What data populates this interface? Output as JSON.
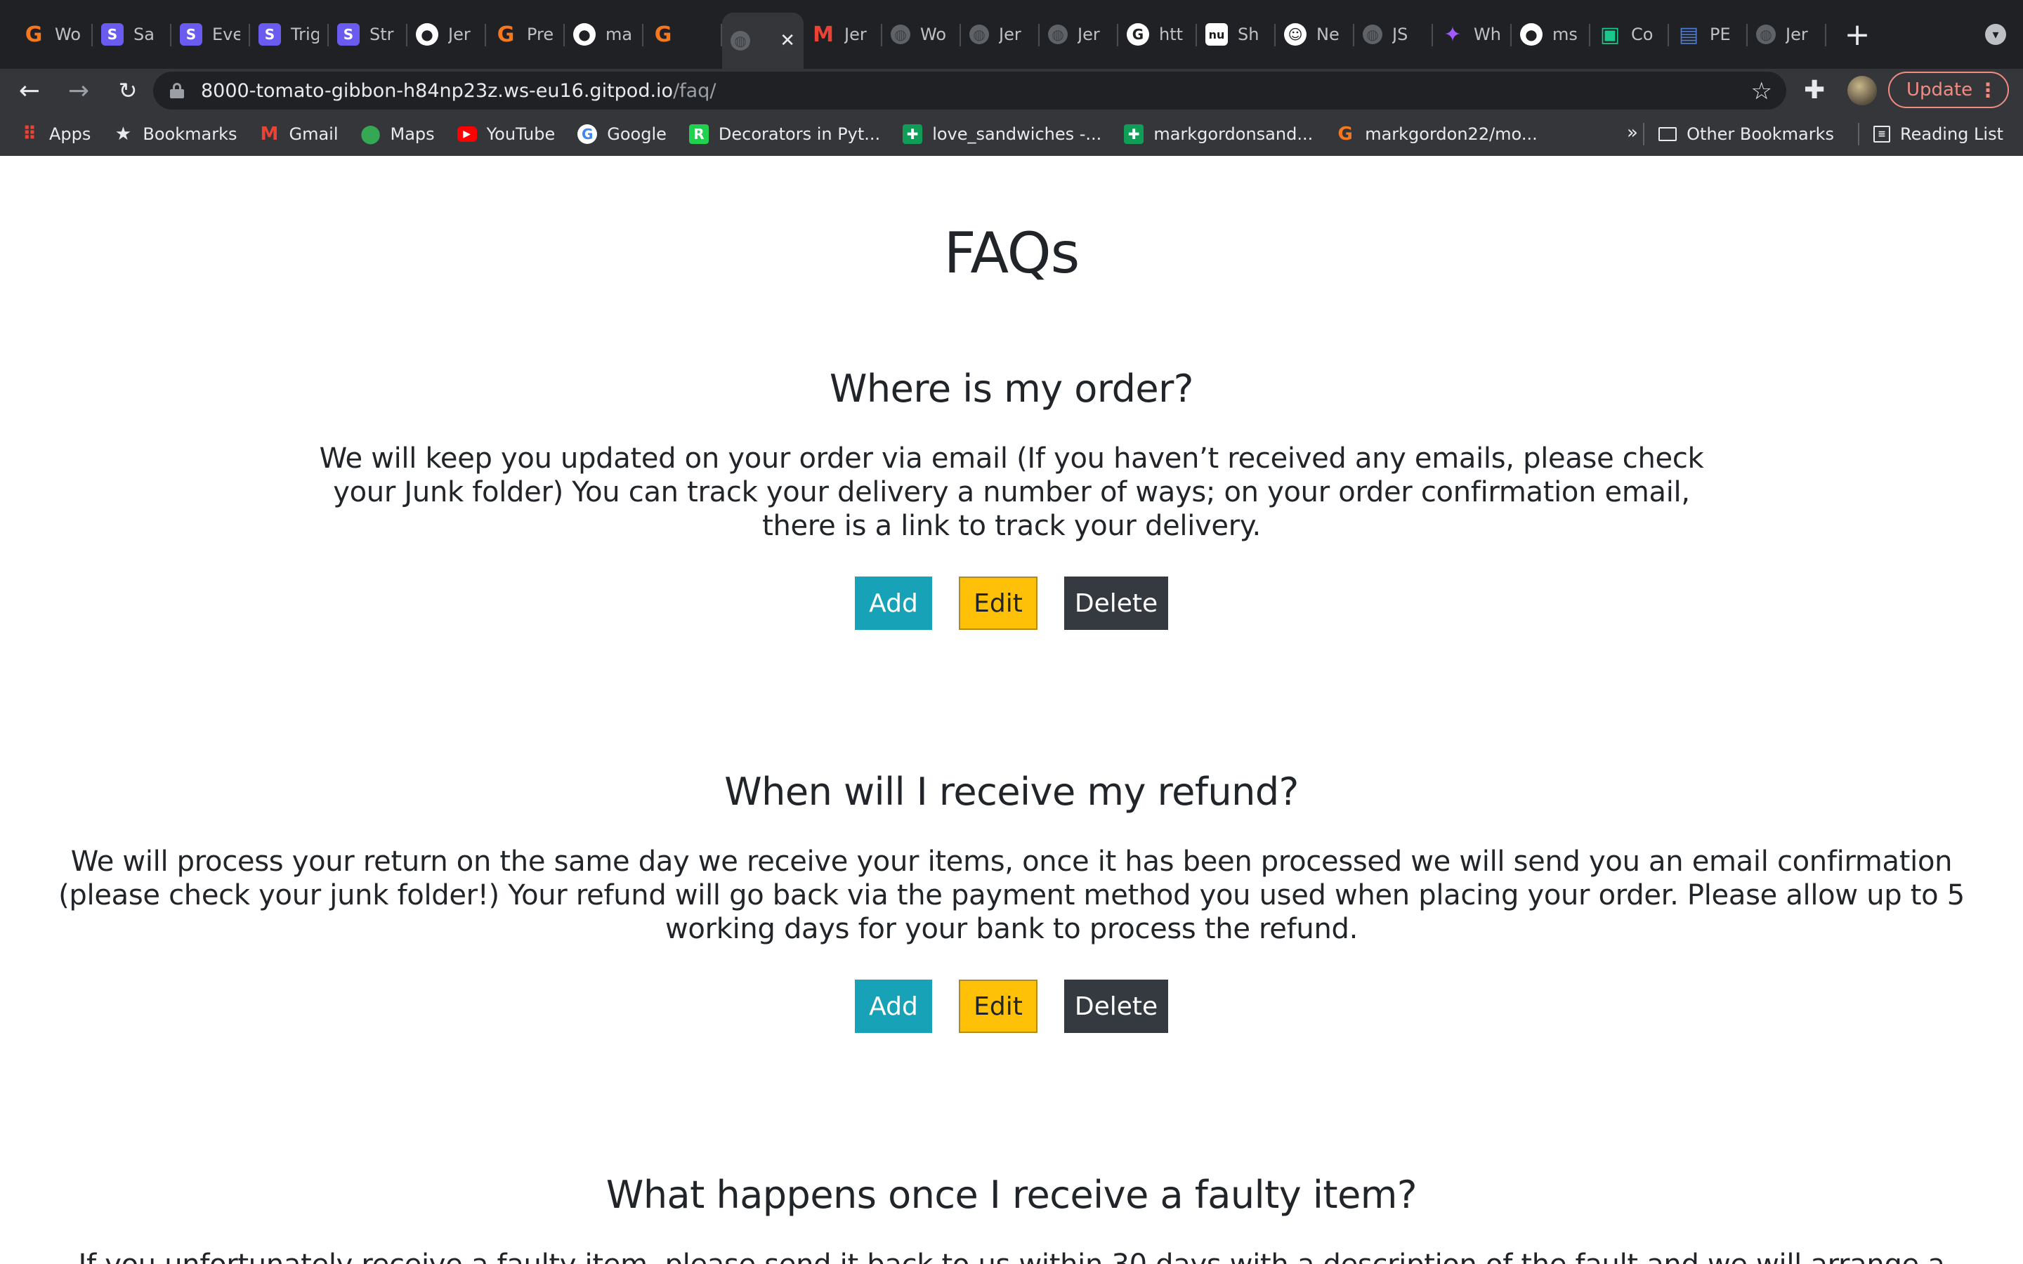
{
  "browser": {
    "tabs": [
      {
        "title": "Wo",
        "icon": "grammarly-icon",
        "color": "#f5781e"
      },
      {
        "title": "Sa",
        "icon": "s-icon",
        "color": "#6b5cf1"
      },
      {
        "title": "Eve",
        "icon": "s-icon",
        "color": "#6b5cf1"
      },
      {
        "title": "Trig",
        "icon": "s-icon",
        "color": "#6b5cf1"
      },
      {
        "title": "Str",
        "icon": "s-icon",
        "color": "#6b5cf1"
      },
      {
        "title": "Jer",
        "icon": "github-icon",
        "color": "#ffffff"
      },
      {
        "title": "Pre",
        "icon": "grammarly-icon",
        "color": "#f5781e"
      },
      {
        "title": "ma",
        "icon": "github-icon",
        "color": "#ffffff"
      },
      {
        "title": "",
        "icon": "grammarly-icon",
        "color": "#f5781e"
      },
      {
        "title": "",
        "icon": "globe-icon",
        "color": "#5f6368",
        "active": true
      },
      {
        "title": "Jer",
        "icon": "gmail-icon",
        "color": "#ea4335"
      },
      {
        "title": "Wo",
        "icon": "globe-icon",
        "color": "#5f6368"
      },
      {
        "title": "Jer",
        "icon": "globe-icon",
        "color": "#5f6368"
      },
      {
        "title": "Jer",
        "icon": "globe-icon",
        "color": "#5f6368"
      },
      {
        "title": "htt",
        "icon": "google-icon",
        "color": "#ffffff"
      },
      {
        "title": "Sh",
        "icon": "nu-icon",
        "color": "#1a1a1a"
      },
      {
        "title": "Ne",
        "icon": "smiley-icon",
        "color": "#ffffff"
      },
      {
        "title": "JS",
        "icon": "globe-icon",
        "color": "#5f6368"
      },
      {
        "title": "Wh",
        "icon": "figma-icon",
        "color": "#a259ff"
      },
      {
        "title": "ms",
        "icon": "github-icon",
        "color": "#ffffff"
      },
      {
        "title": "Co",
        "icon": "codepen-icon",
        "color": "#1ac88c"
      },
      {
        "title": "PE",
        "icon": "doc-icon",
        "color": "#4a7bd0"
      },
      {
        "title": "Jer",
        "icon": "globe-icon",
        "color": "#5f6368"
      }
    ],
    "url_host": "8000-tomato-gibbon-h84np23z.ws-eu16.gitpod.io",
    "url_path": "/faq/",
    "update_label": "Update",
    "bookmarks": [
      {
        "label": "Apps",
        "icon": "apps-grid-icon",
        "color": "#e8eaed"
      },
      {
        "label": "Bookmarks",
        "icon": "star-icon",
        "color": "#e8eaed"
      },
      {
        "label": "Gmail",
        "icon": "gmail-icon",
        "color": "#ea4335"
      },
      {
        "label": "Maps",
        "icon": "maps-pin-icon",
        "color": "#34a853"
      },
      {
        "label": "YouTube",
        "icon": "youtube-icon",
        "color": "#ff0000"
      },
      {
        "label": "Google",
        "icon": "google-icon",
        "color": "#ffffff"
      },
      {
        "label": "Decorators in Pyt...",
        "icon": "rc-icon",
        "color": "#1fd14f"
      },
      {
        "label": "love_sandwiches -...",
        "icon": "sheets-icon",
        "color": "#0f9d58"
      },
      {
        "label": "markgordonsand...",
        "icon": "sheets-icon",
        "color": "#0f9d58"
      },
      {
        "label": "markgordon22/mo...",
        "icon": "grammarly-icon",
        "color": "#f5781e"
      }
    ],
    "other_bookmarks_label": "Other Bookmarks",
    "reading_list_label": "Reading List",
    "overflow_label": "»"
  },
  "page": {
    "title": "FAQs",
    "faqs": [
      {
        "question": "Where is my order?",
        "answer": "We will keep you updated on your order via email (If you haven’t received any emails, please check your Junk folder) You can track your delivery a number of ways; on your order confirmation email, there is a link to track your delivery."
      },
      {
        "question": "When will I receive my refund?",
        "answer": "We will process your return on the same day we receive your items, once it has been processed we will send you an email confirmation (please check your junk folder!) Your refund will go back via the payment method you used when placing your order. Please allow up to 5 working days for your bank to process the refund."
      },
      {
        "question": "What happens once I receive a faulty item?",
        "answer": "If you unfortunately receive a faulty item, please send it back to us within 30 days with a description of the fault and we will arrange a full refund."
      }
    ],
    "buttons": {
      "add": "Add",
      "edit": "Edit",
      "delete": "Delete"
    }
  }
}
